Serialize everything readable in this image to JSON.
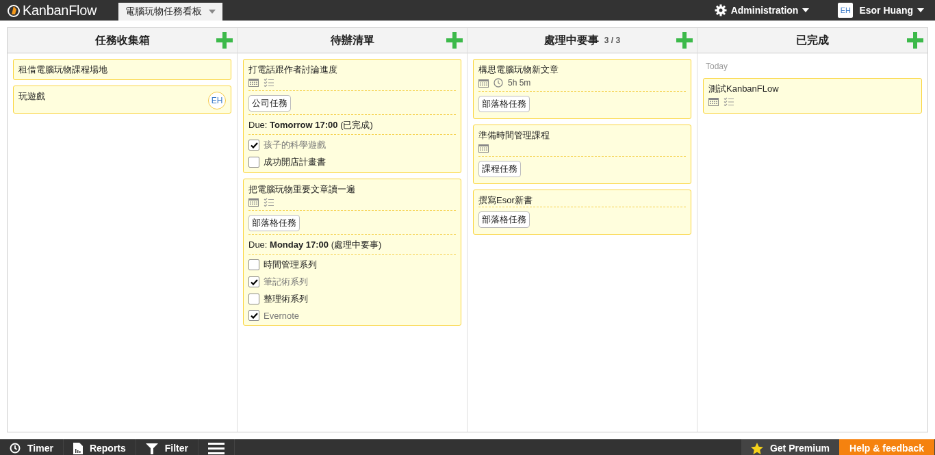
{
  "topbar": {
    "logo": "KanbanFlow",
    "board": "電腦玩物任務看板",
    "admin": "Administration",
    "user_initials": "EH",
    "user": "Esor Huang"
  },
  "columns": [
    {
      "title": "任務收集箱",
      "cards": [
        {
          "title": "租借電腦玩物課程場地"
        },
        {
          "title": "玩遊戲",
          "avatar": "EH"
        }
      ]
    },
    {
      "title": "待辦清單",
      "cards": [
        {
          "title": "打電話跟作者討論進度",
          "has_date": true,
          "has_subtasks": true,
          "tags": [
            "公司任務"
          ],
          "due": "Due: **Tomorrow 17:00** (已完成)",
          "subtasks": [
            {
              "label": "孩子的科學遊戲",
              "checked": true
            },
            {
              "label": "成功開店計畫書",
              "checked": false
            }
          ]
        },
        {
          "title": "把電腦玩物重要文章讀一遍",
          "has_date": true,
          "has_subtasks": true,
          "tags": [
            "部落格任務"
          ],
          "due": "Due: **Monday 17:00** (處理中要事)",
          "subtasks": [
            {
              "label": "時間管理系列",
              "checked": false
            },
            {
              "label": "筆記術系列",
              "checked": true
            },
            {
              "label": "整理術系列",
              "checked": false
            },
            {
              "label": "Evernote",
              "checked": true
            }
          ]
        }
      ]
    },
    {
      "title": "處理中要事",
      "count": "3 / 3",
      "cards": [
        {
          "title": "構思電腦玩物新文章",
          "has_date": true,
          "time_spent": "5h 5m",
          "tags": [
            "部落格任務"
          ]
        },
        {
          "title": "準備時間管理課程",
          "has_date": true,
          "tags": [
            "課程任務"
          ]
        },
        {
          "title": "撰寫Esor新書",
          "tags": [
            "部落格任務"
          ]
        }
      ]
    },
    {
      "title": "已完成",
      "section": "Today",
      "cards": [
        {
          "title": "測試KanbanFLow",
          "has_date": true,
          "has_subtasks": true
        }
      ]
    }
  ],
  "bottombar": {
    "left": [
      {
        "kind": "timer",
        "label": "Timer"
      },
      {
        "kind": "reports",
        "label": "Reports"
      },
      {
        "kind": "filter",
        "label": "Filter"
      },
      {
        "kind": "menu"
      }
    ],
    "premium": "Get Premium",
    "help": "Help & feedback"
  }
}
